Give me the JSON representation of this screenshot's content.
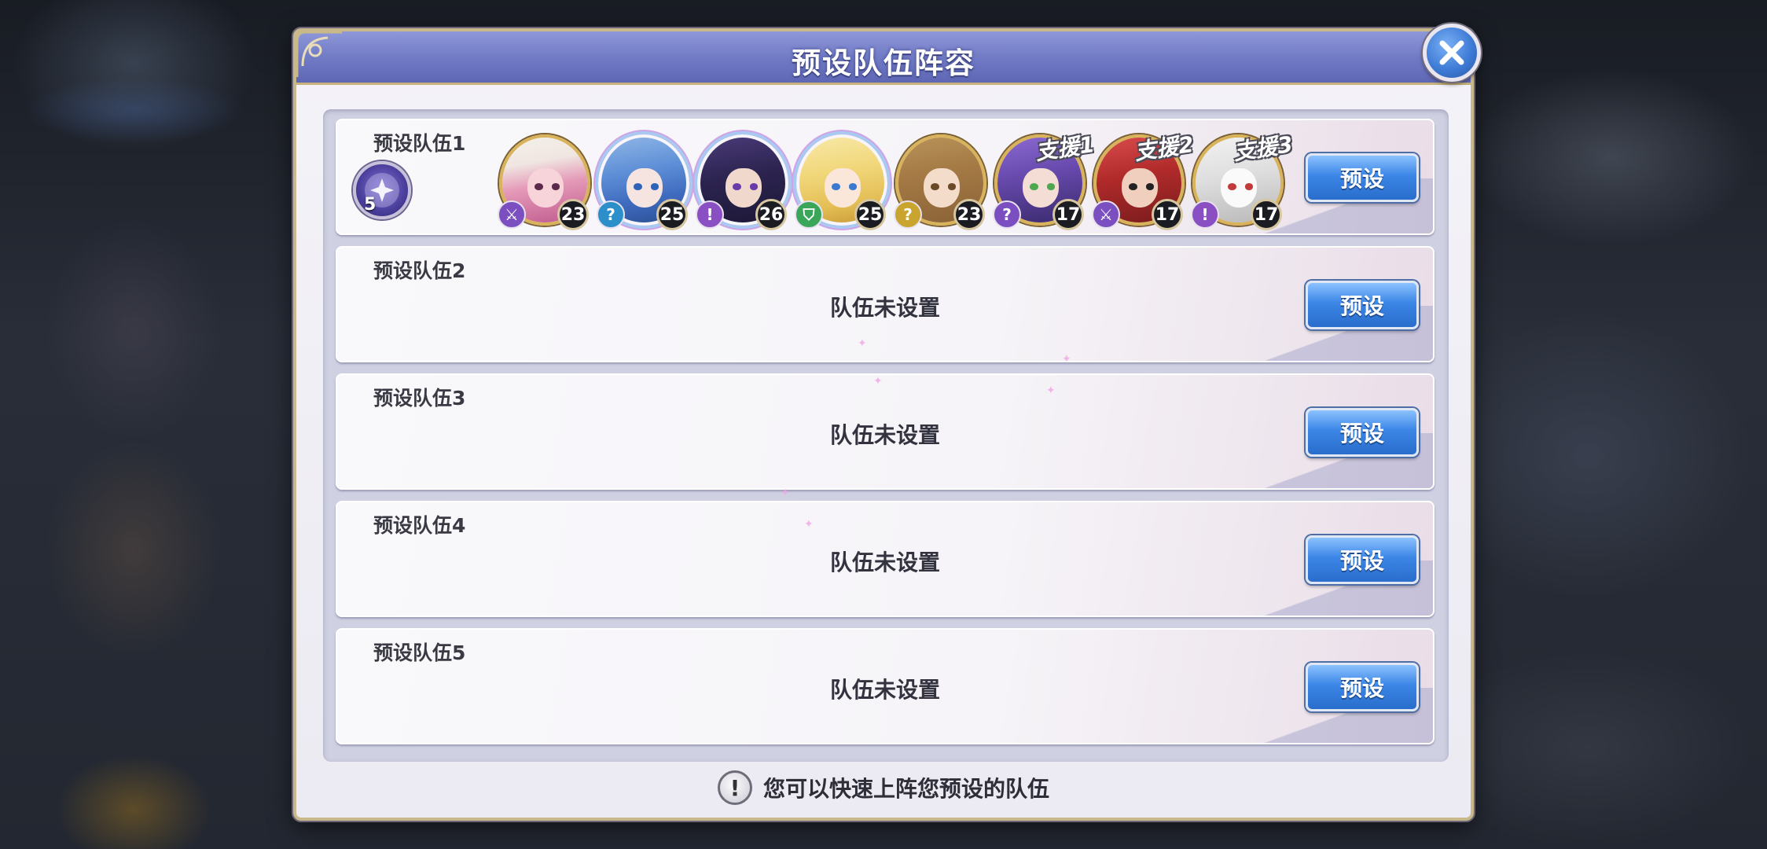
{
  "dialog": {
    "title": "预设队伍阵容",
    "close_icon": "close-x-icon"
  },
  "teams": [
    {
      "label": "预设队伍1",
      "badge_number": "5",
      "button": "预设",
      "heroes": [
        {
          "level": "23",
          "class_icon": "sword-icon",
          "support": ""
        },
        {
          "level": "25",
          "class_icon": "question-icon",
          "support": ""
        },
        {
          "level": "26",
          "class_icon": "exclamation-icon",
          "support": ""
        },
        {
          "level": "25",
          "class_icon": "shield-icon",
          "support": ""
        },
        {
          "level": "23",
          "class_icon": "question-icon",
          "support": ""
        },
        {
          "level": "17",
          "class_icon": "question-icon",
          "support": "支援1"
        },
        {
          "level": "17",
          "class_icon": "sword-icon",
          "support": "支援2"
        },
        {
          "level": "17",
          "class_icon": "exclamation-icon",
          "support": "支援3"
        }
      ]
    },
    {
      "label": "预设队伍2",
      "status": "队伍未设置",
      "button": "预设"
    },
    {
      "label": "预设队伍3",
      "status": "队伍未设置",
      "button": "预设"
    },
    {
      "label": "预设队伍4",
      "status": "队伍未设置",
      "button": "预设"
    },
    {
      "label": "预设队伍5",
      "status": "队伍未设置",
      "button": "预设"
    }
  ],
  "footer": {
    "tip": "您可以快速上阵您预设的队伍",
    "icon": "exclamation-icon"
  },
  "colors": {
    "title_bar": "#6f79c4",
    "button_blue": "#3b86e6",
    "frame_gold": "#c9b98a"
  }
}
